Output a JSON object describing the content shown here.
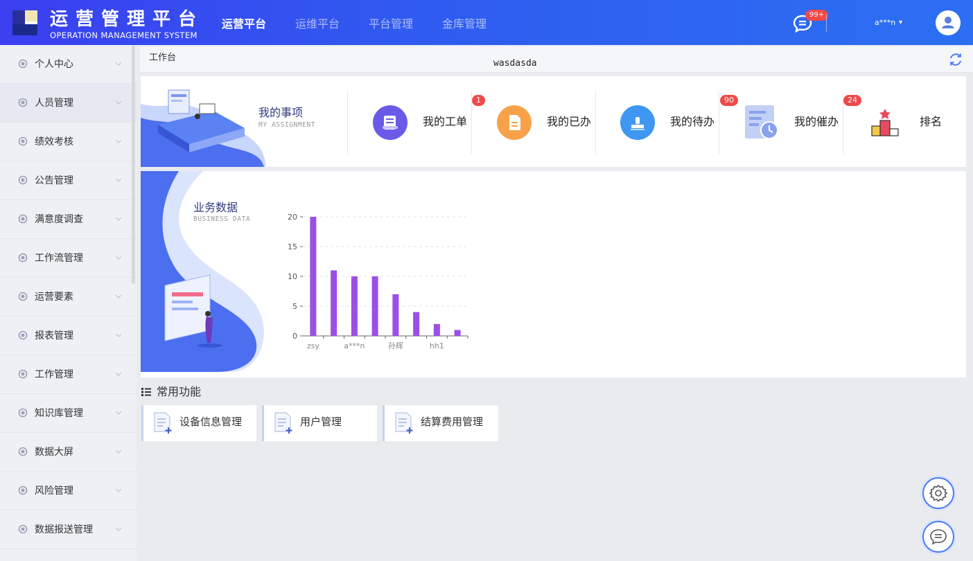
{
  "header": {
    "title": "运营管理平台",
    "subtitle": "OPERATION MANAGEMENT SYSTEM",
    "nav": [
      "运营平台",
      "运维平台",
      "平台管理",
      "金库管理"
    ],
    "active_nav": 0,
    "message_badge": "99+",
    "user_name": "a***n",
    "caret": "▾"
  },
  "sidebar": {
    "items": [
      {
        "label": "个人中心"
      },
      {
        "label": "人员管理"
      },
      {
        "label": "绩效考核"
      },
      {
        "label": "公告管理"
      },
      {
        "label": "满意度调查"
      },
      {
        "label": "工作流管理"
      },
      {
        "label": "运营要素"
      },
      {
        "label": "报表管理"
      },
      {
        "label": "工作管理"
      },
      {
        "label": "知识库管理"
      },
      {
        "label": "数据大屏"
      },
      {
        "label": "风险管理"
      },
      {
        "label": "数据报送管理"
      }
    ]
  },
  "breadcrumb": {
    "current": "工作台",
    "extra": "wasdasda"
  },
  "assignment": {
    "title": "我的事项",
    "subtitle": "MY ASSIGNMENT",
    "items": [
      {
        "label": "我的工单",
        "badge": "1",
        "icon": "work-order-icon",
        "color": "#6a5ae8"
      },
      {
        "label": "我的已办",
        "badge": "",
        "icon": "done-icon",
        "color": "#f7a24a"
      },
      {
        "label": "我的待办",
        "badge": "90",
        "icon": "todo-icon",
        "color": "#3f97f2"
      },
      {
        "label": "我的催办",
        "badge": "24",
        "icon": "urge-icon",
        "color": "#9fb4ee"
      },
      {
        "label": "排名",
        "badge": "",
        "icon": "ranking-icon",
        "color": "#e84a5f"
      }
    ]
  },
  "business": {
    "title": "业务数据",
    "subtitle": "BUSINESS DATA"
  },
  "chart_data": {
    "type": "bar",
    "categories": [
      "zsy",
      "",
      "a***n",
      "",
      "孙辉",
      "",
      "hh1",
      ""
    ],
    "values": [
      20,
      11,
      10,
      10,
      7,
      4,
      2,
      1
    ],
    "yticks": [
      0,
      5,
      10,
      15,
      20
    ],
    "ylim": [
      0,
      20
    ],
    "bar_color": "#9b4fe6",
    "grid": true
  },
  "common": {
    "title": "常用功能",
    "items": [
      {
        "label": "设备信息管理"
      },
      {
        "label": "用户管理"
      },
      {
        "label": "结算费用管理"
      }
    ]
  },
  "colors": {
    "header_start": "#3b3ff0",
    "header_end": "#2c6ff2",
    "badge": "#ee4a4a",
    "accent": "#4b7cf3"
  }
}
